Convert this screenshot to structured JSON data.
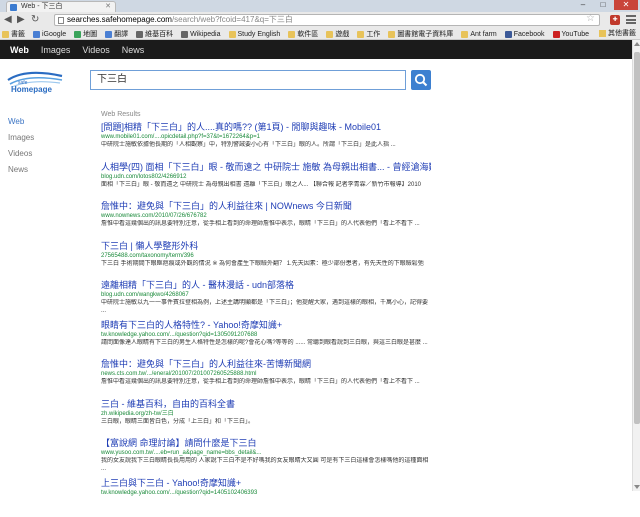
{
  "browser": {
    "tab_title": "Web - 下三白",
    "url_host": "searches.safehomepage.com",
    "url_path": "/search/web?fcoid=417&q=下三白",
    "bookmarks": [
      {
        "label": "書籤",
        "color": "#e8c35a"
      },
      {
        "label": "iGoogle",
        "color": "#4a7fd3"
      },
      {
        "label": "地圖",
        "color": "#3aa35a"
      },
      {
        "label": "翻譯",
        "color": "#4a7fd3"
      },
      {
        "label": "維基百科",
        "color": "#666666"
      },
      {
        "label": "Wikipedia",
        "color": "#666666"
      },
      {
        "label": "Study English",
        "color": "#e8c35a"
      },
      {
        "label": "軟件區",
        "color": "#e8c35a"
      },
      {
        "label": "遊戲",
        "color": "#e8c35a"
      },
      {
        "label": "工作",
        "color": "#e8c35a"
      },
      {
        "label": "圖書館電子資料庫",
        "color": "#e8c35a"
      },
      {
        "label": "Ant farm",
        "color": "#e8c35a"
      },
      {
        "label": "Facebook",
        "color": "#3b5998"
      },
      {
        "label": "YouTube",
        "color": "#cc2020"
      }
    ],
    "other_bookmarks": "其他書籤"
  },
  "topnav": {
    "items": [
      "Web",
      "Images",
      "Videos",
      "News"
    ],
    "active": "Web"
  },
  "logo": {
    "line1": "safe",
    "line2": "Homepage"
  },
  "search": {
    "query": "下三白"
  },
  "sidebar": {
    "items": [
      "Web",
      "Images",
      "Videos",
      "News"
    ]
  },
  "results_label": "Web Results",
  "results": [
    {
      "title": "[問題]相精「下三白」的人....真的嗎?? (第1頁) - 閒聊與趣味 - Mobile01",
      "url": "www.mobile01.com/....opicdetail.php?f=37&t=1672264&p=1",
      "snippet": "中研院士施敏依據他長期的「人相觀察」中，特別警誡要小心有「下三白」眼的人。所謂「下三白」是此人指 ..."
    },
    {
      "title": "人相學(四) 面相「下三白」眼 - 敬而遠之 中研院士 施敏 為母親出相書... - 曾經滄海難為水 ... - udn部落格",
      "url": "blog.udn.com/lotos802/4266912",
      "snippet": "面相「下三白」眼 - 敬而遠之 中研院士 為母親出相書 遠離「下三白」眼之人... 【聯合報 記者李青霖／新竹市報導】2010"
    },
    {
      "title": "詹惟中：避免與「下三白」的人利益往來 | NOWnews 今日新聞",
      "url": "www.nownews.com/2010/07/26/676782",
      "snippet": "詹惟中看這幾個出的訊息要特別注意，從手相上看到的命理師詹惟中表示，眼睛「下三白」的人代表他們「看上不看下 ..."
    },
    {
      "title": "下三白 | 懶人學整形外科",
      "url": "27565488.com/taxonomy/term/396",
      "snippet": "下三白 手術期間下眼眶疤痕或外觀的情況 ※ 為何會產生下眼瞼外翻？ 1.先天因素：極少部份患者，有先天性的下眼瞼鬆弛"
    },
    {
      "title": "遠離相精「下三白」的人 - 醫林漫話 - udn部落格",
      "url": "blog.udn.com/wangkwo/4268067",
      "snippet": "中研院士施敏以九一一事件賓拉登相為例，上述主講明顯都是「下三白」；他提醒大家，遇到這樣的眼相，千萬小心，記得要 ..."
    },
    {
      "title": "眼睛有下三白的人格特性? - Yahoo!奇摩知識+",
      "url": "tw.knowledge.yahoo.com/.../question?qid=1305091207688",
      "snippet": "請問面像達人眼睛有下三白的男生人格特性是怎樣的呢?會花心嗎?等等的 ...... 常聽到眼看說到三白眼，與這三白眼是甚麼 ..."
    },
    {
      "title": "詹惟中：避免與「下三白」的人利益往來-苦博新聞網",
      "url": "news.cts.com.tw/.../eneral/201007/201007260525888.html",
      "snippet": "詹惟中看這幾個出的訊息要特別注意，從手相上看到的命理師詹惟中表示，眼睛「下三白」的人代表他們「看上不看下 ..."
    },
    {
      "title": "三白 - 維基百科，自由的百科全書",
      "url": "zh.wikipedia.org/zh-tw/三白",
      "snippet": "三白眼，眼睛三面皆白色，分成「上三白」和「下三白」。"
    },
    {
      "title": "【富說網 命理討論】請問什麼是下三白",
      "url": "www.yusoo.com.tw/....eb=run_a&page_name=bbs_detail&...",
      "snippet": "我的女友說我下三白眼睛長長用用的 人家說下三白不是不好嗎我的女友眼睛大又圓 可是有下三白這樣會怎樣嗎他的這種面相 ..."
    },
    {
      "title": "上三白與下三白 - Yahoo!奇摩知識+",
      "url": "tw.knowledge.yahoo.com/.../question?qid=1405102406393",
      "snippet": ""
    }
  ]
}
